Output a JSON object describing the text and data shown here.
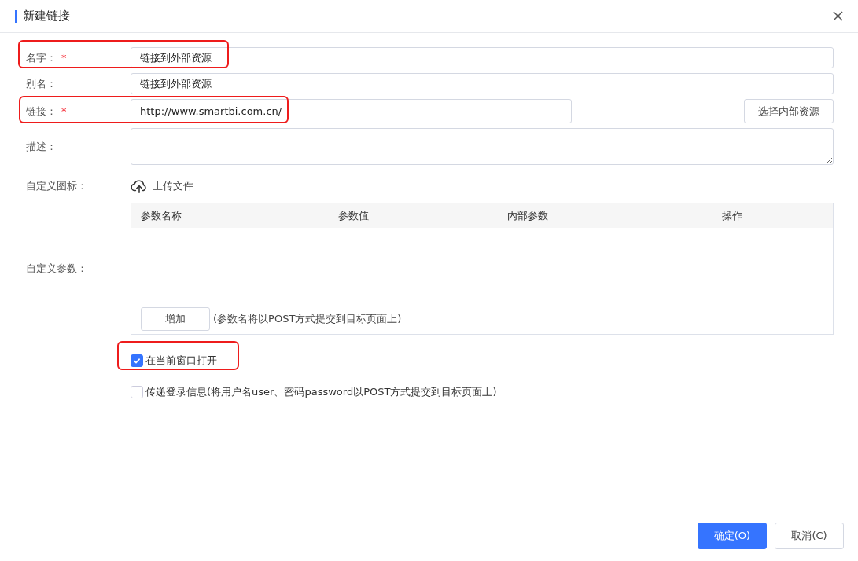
{
  "dialog": {
    "title": "新建链接"
  },
  "fields": [
    {
      "kind": "input",
      "label": "名字：",
      "required_mark": "*",
      "value": "链接到外部资源",
      "highlighted": true
    },
    {
      "kind": "input",
      "label": "别名：",
      "value": "链接到外部资源",
      "highlighted": false
    },
    {
      "kind": "input-button",
      "label": "链接：",
      "required_mark": "*",
      "value": "http://www.smartbi.com.cn/",
      "button": "选择内部资源",
      "highlighted": true
    },
    {
      "kind": "textarea",
      "label": "描述：",
      "highlighted": false
    },
    {
      "kind": "upload",
      "label": "自定义图标：",
      "action": "上传文件",
      "highlighted": false
    },
    {
      "kind": "table",
      "label": "自定义参数：",
      "highlighted": false,
      "columns": [
        "参数名称",
        "参数值",
        "内部参数",
        "操作"
      ],
      "add_button": "增加",
      "note": "(参数名将以POST方式提交到目标页面上)"
    }
  ],
  "options": [
    {
      "label": "在当前窗口打开",
      "checked": true,
      "highlighted": true
    },
    {
      "label": "传递登录信息(将用户名user、密码password以POST方式提交到目标页面上)",
      "checked": false,
      "highlighted": false
    }
  ],
  "buttons": [
    {
      "label": "确定(O)",
      "primary": true
    },
    {
      "label": "取消(C)",
      "primary": false
    }
  ]
}
